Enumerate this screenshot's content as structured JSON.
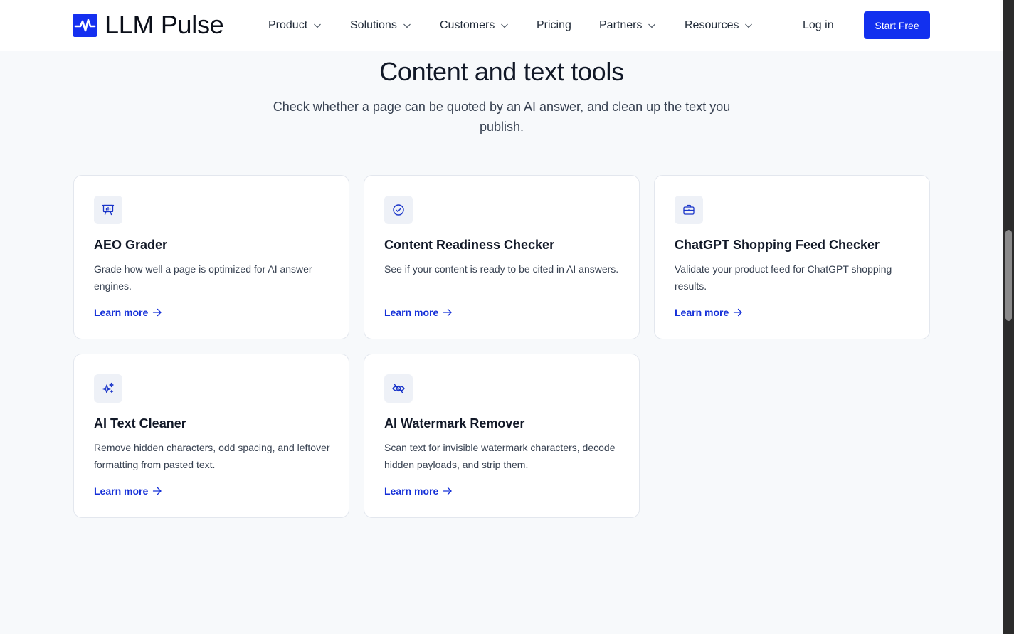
{
  "header": {
    "logo_text": "LLM Pulse",
    "nav": [
      {
        "label": "Product",
        "has_dropdown": true
      },
      {
        "label": "Solutions",
        "has_dropdown": true
      },
      {
        "label": "Customers",
        "has_dropdown": true
      },
      {
        "label": "Pricing",
        "has_dropdown": false
      },
      {
        "label": "Partners",
        "has_dropdown": true
      },
      {
        "label": "Resources",
        "has_dropdown": true
      }
    ],
    "login_label": "Log in",
    "cta_label": "Start Free"
  },
  "section": {
    "title": "Content and text tools",
    "subtitle": "Check whether a page can be quoted by an AI answer, and clean up the text you publish."
  },
  "cards": [
    {
      "icon": "presentation-chart-icon",
      "title": "AEO Grader",
      "description": "Grade how well a page is optimized for AI answer engines.",
      "link": "Learn more"
    },
    {
      "icon": "check-circle-icon",
      "title": "Content Readiness Checker",
      "description": "See if your content is ready to be cited in AI answers.",
      "link": "Learn more"
    },
    {
      "icon": "briefcase-icon",
      "title": "ChatGPT Shopping Feed Checker",
      "description": "Validate your product feed for ChatGPT shopping results.",
      "link": "Learn more"
    },
    {
      "icon": "sparkles-icon",
      "title": "AI Text Cleaner",
      "description": "Remove hidden characters, odd spacing, and leftover formatting from pasted text.",
      "link": "Learn more"
    },
    {
      "icon": "eye-slash-icon",
      "title": "AI Watermark Remover",
      "description": "Scan text for invisible watermark characters, decode hidden payloads, and strip them.",
      "link": "Learn more"
    }
  ],
  "colors": {
    "brand": "#1230ef",
    "link": "#1530d8",
    "background": "#f7f9fb"
  }
}
